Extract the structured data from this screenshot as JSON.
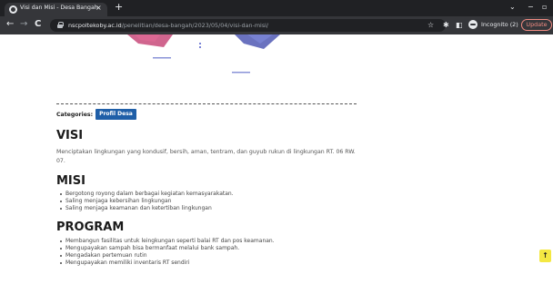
{
  "browser": {
    "tab": {
      "title": "Visi dan Misi - Desa Bangah",
      "close": "×"
    },
    "new_tab": "+",
    "window_controls": {
      "chevron": "⌄",
      "minimize": "−",
      "maximize": "▫"
    },
    "nav": {
      "back": "←",
      "forward": "→",
      "reload": "C"
    },
    "url": {
      "host": "nscpoltekoby.ac.id",
      "path": "/penelitian/desa-bangah/2023/05/04/visi-dan-misi/"
    },
    "toolbar_icons": {
      "star": "☆",
      "extensions": "✱",
      "sidepanel": "◧"
    },
    "incognito_label": "Incognito (2)",
    "update_label": "Update"
  },
  "post": {
    "categories_label": "Categories:",
    "category": "Profil Desa",
    "visi": {
      "heading": "VISI",
      "text": "Menciptakan lingkungan yang kondusif, bersih, aman, tentram, dan guyub rukun di lingkungan RT. 06 RW. 07."
    },
    "misi": {
      "heading": "MISI",
      "items": [
        "Bergotong royong dalam berbagai kegiatan kemasyarakatan.",
        "Saling menjaga kebersihan lingkungan",
        "Saling menjaga keamanan dan ketertiban lingkungan"
      ]
    },
    "program": {
      "heading": "PROGRAM",
      "items": [
        "Membangun fasilitas untuk leingkungan seperti balai RT dan pos keamanan.",
        "Mengupayakan sampah bisa bermanfaat melalui bank sampah.",
        "Mengadakan pertemuan rutin",
        "Mengupayakan memiliki inventaris RT sendiri"
      ]
    }
  },
  "scroll_top_icon": "↑",
  "colors": {
    "category_badge": "#1f5fa8",
    "scroll_top": "#f4e842",
    "update": "#f28b82"
  }
}
